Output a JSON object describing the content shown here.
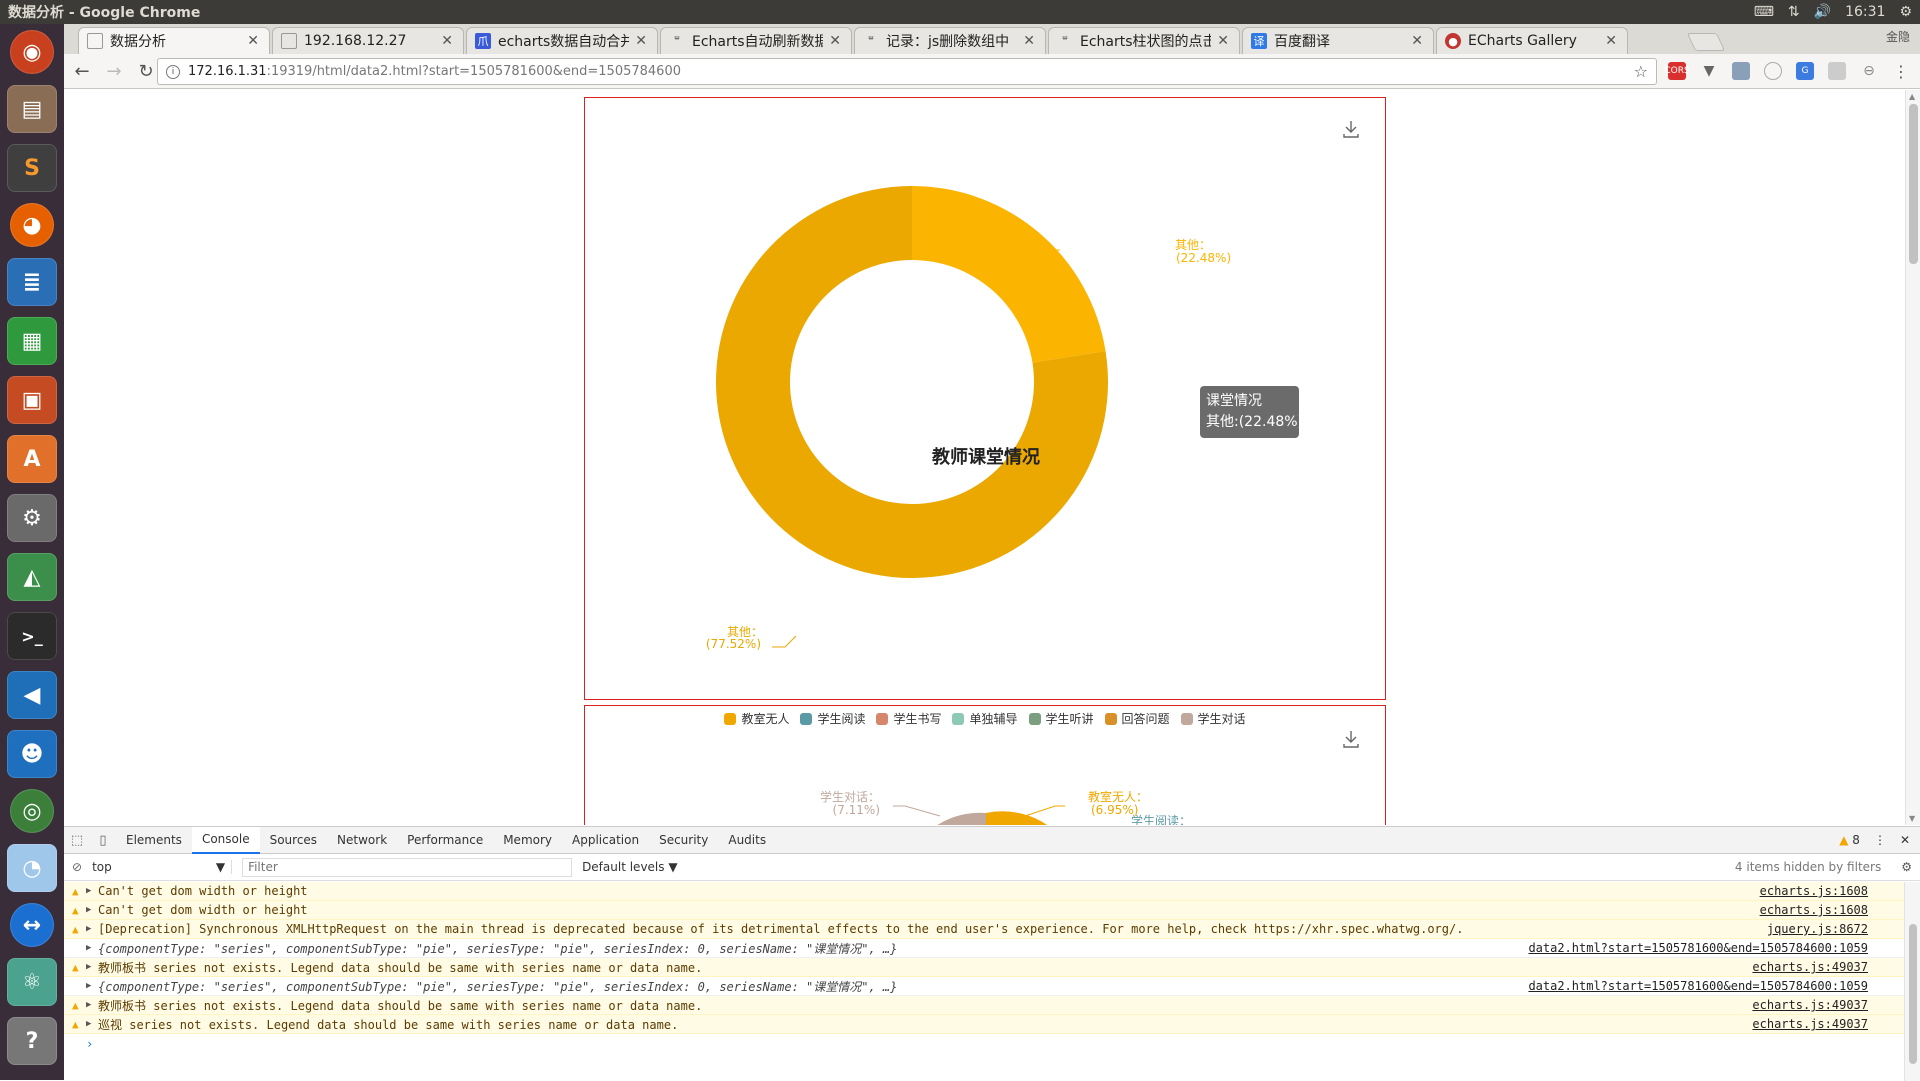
{
  "window": {
    "title": "数据分析 - Google Chrome"
  },
  "top_panel": {
    "time": "16:31",
    "volume": "🔊",
    "network": "⇅",
    "keyboard": "⌨",
    "settings": "⚙"
  },
  "tabs": [
    {
      "title": "数据分析",
      "active": true
    },
    {
      "title": "192.168.12.27"
    },
    {
      "title": "echarts数据自动合并"
    },
    {
      "title": "Echarts自动刷新数据"
    },
    {
      "title": "记录：js删除数组中"
    },
    {
      "title": "Echarts柱状图的点击"
    },
    {
      "title": "百度翻译"
    },
    {
      "title": "ECharts Gallery"
    }
  ],
  "profile_label": "金隐",
  "address": {
    "host": "172.16.1.31",
    "rest": ":19319/html/data2.html?start=1505781600&end=1505784600"
  },
  "chart1": {
    "center_title": "教师课堂情况",
    "tooltip": {
      "title": "课堂情况",
      "line": "其他:(22.48%)"
    },
    "label_top": {
      "name": "其他：",
      "pct": "(22.48%)"
    },
    "label_bottom": {
      "name": "其他：",
      "pct": "(77.52%)"
    }
  },
  "chart2": {
    "legend": [
      {
        "label": "教室无人",
        "color": "#f0a800"
      },
      {
        "label": "学生阅读",
        "color": "#5a9aa5"
      },
      {
        "label": "学生书写",
        "color": "#d6866a"
      },
      {
        "label": "单独辅导",
        "color": "#8ec9b4"
      },
      {
        "label": "学生听讲",
        "color": "#7a9e7e"
      },
      {
        "label": "回答问题",
        "color": "#d99028"
      },
      {
        "label": "学生对话",
        "color": "#c0a89c"
      }
    ],
    "label_left": {
      "name": "学生对话：",
      "pct": "(7.11%)"
    },
    "label_right": {
      "name": "教室无人：",
      "pct": "(6.95%)"
    },
    "label_right2": "学生阅读："
  },
  "chart_data": [
    {
      "type": "pie",
      "title": "教师课堂情况",
      "series_name": "课堂情况",
      "slices": [
        {
          "name": "其他",
          "value": 22.48,
          "color": "#fbb400"
        },
        {
          "name": "其他",
          "value": 77.52,
          "color": "#eaa800"
        }
      ]
    }
  ],
  "devtools": {
    "tabs": [
      "Elements",
      "Console",
      "Sources",
      "Network",
      "Performance",
      "Memory",
      "Application",
      "Security",
      "Audits"
    ],
    "active_tab": "Console",
    "warn_count": "8",
    "context": "top",
    "filter_placeholder": "Filter",
    "levels": "Default levels ▼",
    "hidden_note": "4 items hidden by filters",
    "logs": [
      {
        "kind": "warn",
        "msg": "Can't get dom width or height",
        "src": "echarts.js:1608"
      },
      {
        "kind": "warn",
        "msg": "Can't get dom width or height",
        "src": "echarts.js:1608"
      },
      {
        "kind": "warn",
        "msg": "[Deprecation] Synchronous XMLHttpRequest on the main thread is deprecated because of its detrimental effects to the end user's experience. For more help, check https://xhr.spec.whatwg.org/.",
        "src": "jquery.js:8672"
      },
      {
        "kind": "log",
        "msg": "{componentType: \"series\", componentSubType: \"pie\", seriesType: \"pie\", seriesIndex: 0, seriesName: \"课堂情况\", …}",
        "src": "data2.html?start=1505781600&end=1505784600:1059"
      },
      {
        "kind": "warn",
        "msg": "教师板书 series not exists. Legend data should be same with series name or data name.",
        "src": "echarts.js:49037"
      },
      {
        "kind": "log",
        "msg": "{componentType: \"series\", componentSubType: \"pie\", seriesType: \"pie\", seriesIndex: 0, seriesName: \"课堂情况\", …}",
        "src": "data2.html?start=1505781600&end=1505784600:1059"
      },
      {
        "kind": "warn",
        "msg": "教师板书 series not exists. Legend data should be same with series name or data name.",
        "src": "echarts.js:49037"
      },
      {
        "kind": "warn",
        "msg": "巡视 series not exists. Legend data should be same with series name or data name.",
        "src": "echarts.js:49037"
      }
    ]
  }
}
